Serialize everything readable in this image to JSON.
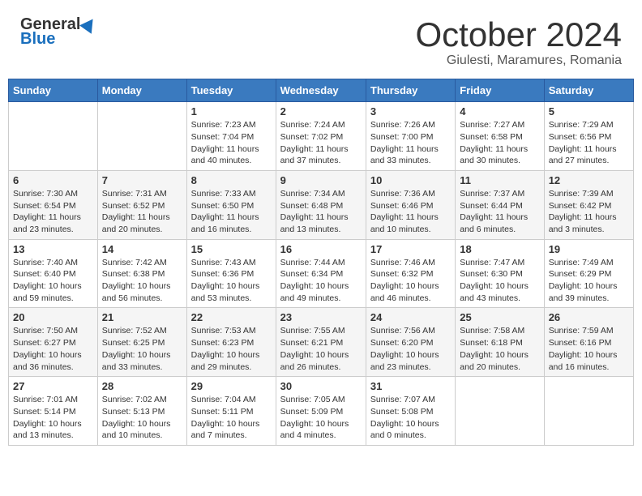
{
  "header": {
    "logo_general": "General",
    "logo_blue": "Blue",
    "month_title": "October 2024",
    "location": "Giulesti, Maramures, Romania"
  },
  "days_of_week": [
    "Sunday",
    "Monday",
    "Tuesday",
    "Wednesday",
    "Thursday",
    "Friday",
    "Saturday"
  ],
  "weeks": [
    [
      {
        "day": "",
        "info": ""
      },
      {
        "day": "",
        "info": ""
      },
      {
        "day": "1",
        "info": "Sunrise: 7:23 AM\nSunset: 7:04 PM\nDaylight: 11 hours and 40 minutes."
      },
      {
        "day": "2",
        "info": "Sunrise: 7:24 AM\nSunset: 7:02 PM\nDaylight: 11 hours and 37 minutes."
      },
      {
        "day": "3",
        "info": "Sunrise: 7:26 AM\nSunset: 7:00 PM\nDaylight: 11 hours and 33 minutes."
      },
      {
        "day": "4",
        "info": "Sunrise: 7:27 AM\nSunset: 6:58 PM\nDaylight: 11 hours and 30 minutes."
      },
      {
        "day": "5",
        "info": "Sunrise: 7:29 AM\nSunset: 6:56 PM\nDaylight: 11 hours and 27 minutes."
      }
    ],
    [
      {
        "day": "6",
        "info": "Sunrise: 7:30 AM\nSunset: 6:54 PM\nDaylight: 11 hours and 23 minutes."
      },
      {
        "day": "7",
        "info": "Sunrise: 7:31 AM\nSunset: 6:52 PM\nDaylight: 11 hours and 20 minutes."
      },
      {
        "day": "8",
        "info": "Sunrise: 7:33 AM\nSunset: 6:50 PM\nDaylight: 11 hours and 16 minutes."
      },
      {
        "day": "9",
        "info": "Sunrise: 7:34 AM\nSunset: 6:48 PM\nDaylight: 11 hours and 13 minutes."
      },
      {
        "day": "10",
        "info": "Sunrise: 7:36 AM\nSunset: 6:46 PM\nDaylight: 11 hours and 10 minutes."
      },
      {
        "day": "11",
        "info": "Sunrise: 7:37 AM\nSunset: 6:44 PM\nDaylight: 11 hours and 6 minutes."
      },
      {
        "day": "12",
        "info": "Sunrise: 7:39 AM\nSunset: 6:42 PM\nDaylight: 11 hours and 3 minutes."
      }
    ],
    [
      {
        "day": "13",
        "info": "Sunrise: 7:40 AM\nSunset: 6:40 PM\nDaylight: 10 hours and 59 minutes."
      },
      {
        "day": "14",
        "info": "Sunrise: 7:42 AM\nSunset: 6:38 PM\nDaylight: 10 hours and 56 minutes."
      },
      {
        "day": "15",
        "info": "Sunrise: 7:43 AM\nSunset: 6:36 PM\nDaylight: 10 hours and 53 minutes."
      },
      {
        "day": "16",
        "info": "Sunrise: 7:44 AM\nSunset: 6:34 PM\nDaylight: 10 hours and 49 minutes."
      },
      {
        "day": "17",
        "info": "Sunrise: 7:46 AM\nSunset: 6:32 PM\nDaylight: 10 hours and 46 minutes."
      },
      {
        "day": "18",
        "info": "Sunrise: 7:47 AM\nSunset: 6:30 PM\nDaylight: 10 hours and 43 minutes."
      },
      {
        "day": "19",
        "info": "Sunrise: 7:49 AM\nSunset: 6:29 PM\nDaylight: 10 hours and 39 minutes."
      }
    ],
    [
      {
        "day": "20",
        "info": "Sunrise: 7:50 AM\nSunset: 6:27 PM\nDaylight: 10 hours and 36 minutes."
      },
      {
        "day": "21",
        "info": "Sunrise: 7:52 AM\nSunset: 6:25 PM\nDaylight: 10 hours and 33 minutes."
      },
      {
        "day": "22",
        "info": "Sunrise: 7:53 AM\nSunset: 6:23 PM\nDaylight: 10 hours and 29 minutes."
      },
      {
        "day": "23",
        "info": "Sunrise: 7:55 AM\nSunset: 6:21 PM\nDaylight: 10 hours and 26 minutes."
      },
      {
        "day": "24",
        "info": "Sunrise: 7:56 AM\nSunset: 6:20 PM\nDaylight: 10 hours and 23 minutes."
      },
      {
        "day": "25",
        "info": "Sunrise: 7:58 AM\nSunset: 6:18 PM\nDaylight: 10 hours and 20 minutes."
      },
      {
        "day": "26",
        "info": "Sunrise: 7:59 AM\nSunset: 6:16 PM\nDaylight: 10 hours and 16 minutes."
      }
    ],
    [
      {
        "day": "27",
        "info": "Sunrise: 7:01 AM\nSunset: 5:14 PM\nDaylight: 10 hours and 13 minutes."
      },
      {
        "day": "28",
        "info": "Sunrise: 7:02 AM\nSunset: 5:13 PM\nDaylight: 10 hours and 10 minutes."
      },
      {
        "day": "29",
        "info": "Sunrise: 7:04 AM\nSunset: 5:11 PM\nDaylight: 10 hours and 7 minutes."
      },
      {
        "day": "30",
        "info": "Sunrise: 7:05 AM\nSunset: 5:09 PM\nDaylight: 10 hours and 4 minutes."
      },
      {
        "day": "31",
        "info": "Sunrise: 7:07 AM\nSunset: 5:08 PM\nDaylight: 10 hours and 0 minutes."
      },
      {
        "day": "",
        "info": ""
      },
      {
        "day": "",
        "info": ""
      }
    ]
  ]
}
